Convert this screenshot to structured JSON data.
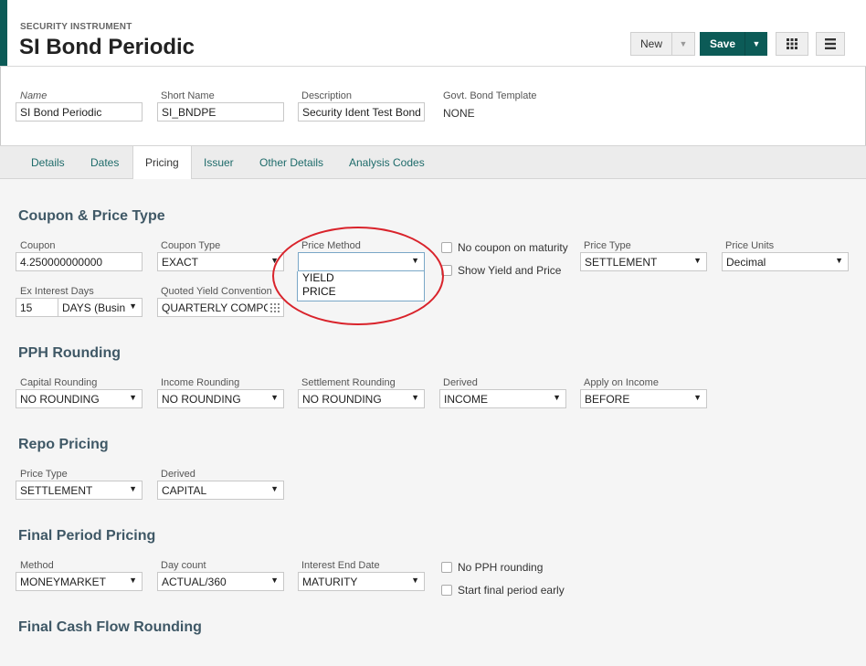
{
  "header": {
    "breadcrumb": "SECURITY INSTRUMENT",
    "title": "SI Bond Periodic",
    "new_label": "New",
    "save_label": "Save"
  },
  "top_fields": {
    "name": {
      "label": "Name",
      "value": "SI Bond Periodic"
    },
    "short_name": {
      "label": "Short Name",
      "value": "SI_BNDPE"
    },
    "description": {
      "label": "Description",
      "value": "Security Ident Test Bond"
    },
    "govt_bond_template": {
      "label": "Govt. Bond Template",
      "value": "NONE"
    }
  },
  "tabs": [
    {
      "label": "Details"
    },
    {
      "label": "Dates"
    },
    {
      "label": "Pricing"
    },
    {
      "label": "Issuer"
    },
    {
      "label": "Other Details"
    },
    {
      "label": "Analysis Codes"
    }
  ],
  "coupon_price": {
    "title": "Coupon & Price Type",
    "coupon": {
      "label": "Coupon",
      "value": "4.250000000000"
    },
    "coupon_type": {
      "label": "Coupon Type",
      "value": "EXACT"
    },
    "price_method": {
      "label": "Price Method",
      "value": "",
      "options": [
        "YIELD",
        "PRICE"
      ]
    },
    "no_coupon_on_maturity": "No coupon on maturity",
    "show_yield_and_price": "Show Yield and Price",
    "price_type": {
      "label": "Price Type",
      "value": "SETTLEMENT"
    },
    "price_units": {
      "label": "Price Units",
      "value": "Decimal"
    },
    "ex_interest_days": {
      "label": "Ex Interest Days",
      "value": "15",
      "unit": "DAYS (Busin"
    },
    "quoted_yield_convention": {
      "label": "Quoted Yield Convention",
      "value": "QUARTERLY COMPO"
    }
  },
  "pph_rounding": {
    "title": "PPH Rounding",
    "capital_rounding": {
      "label": "Capital Rounding",
      "value": "NO ROUNDING"
    },
    "income_rounding": {
      "label": "Income Rounding",
      "value": "NO ROUNDING"
    },
    "settlement_rounding": {
      "label": "Settlement Rounding",
      "value": "NO ROUNDING"
    },
    "derived": {
      "label": "Derived",
      "value": "INCOME"
    },
    "apply_on_income": {
      "label": "Apply on Income",
      "value": "BEFORE"
    }
  },
  "repo_pricing": {
    "title": "Repo Pricing",
    "price_type": {
      "label": "Price Type",
      "value": "SETTLEMENT"
    },
    "derived": {
      "label": "Derived",
      "value": "CAPITAL"
    }
  },
  "final_period": {
    "title": "Final Period Pricing",
    "method": {
      "label": "Method",
      "value": "MONEYMARKET"
    },
    "day_count": {
      "label": "Day count",
      "value": "ACTUAL/360"
    },
    "interest_end_date": {
      "label": "Interest End Date",
      "value": "MATURITY"
    },
    "no_pph_rounding": "No PPH rounding",
    "start_final_period_early": "Start final period early"
  },
  "final_cash_flow": {
    "title": "Final Cash Flow Rounding"
  },
  "colors": {
    "brand": "#0c5b57",
    "tab_link": "#1e6b6a",
    "section_title": "#3f5866",
    "annotation": "#d9232b"
  }
}
